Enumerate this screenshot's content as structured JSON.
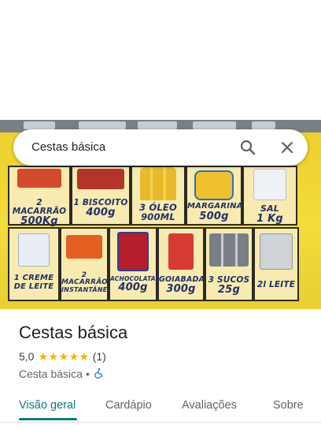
{
  "search": {
    "query": "Cestas básica",
    "search_icon": "search-icon",
    "clear_icon": "close-icon"
  },
  "photo": {
    "products": [
      {
        "line1": "2 MACARRÃO",
        "line2": "500Kg"
      },
      {
        "line1": "1 BISCOITO",
        "line2": "400g"
      },
      {
        "line1": "3 ÓLEO",
        "line2": "900ML"
      },
      {
        "line1": "MARGARINA",
        "line2": "500g"
      },
      {
        "line1": "SAL",
        "line2": "1 Kg"
      },
      {
        "line1": "1 CREME",
        "line2": "DE LEITE"
      },
      {
        "line1": "2 MACARRÃO",
        "line2": "INSTANTÂNEO"
      },
      {
        "line1": "ACHOCOLATADO",
        "line2": "400g"
      },
      {
        "line1": "GOIABADA",
        "line2": "300g"
      },
      {
        "line1": "3 SUCOS",
        "line2": "25g"
      },
      {
        "line1": "2l LEITE",
        "line2": ""
      }
    ]
  },
  "place": {
    "title": "Cestas básica",
    "rating": "5,0",
    "stars": "★★★★★",
    "review_count": "(1)",
    "category": "Cesta básica",
    "separator": "•",
    "accessibility_icon": "wheelchair-icon"
  },
  "tabs": [
    {
      "label": "Visão geral",
      "active": true
    },
    {
      "label": "Cardápio",
      "active": false
    },
    {
      "label": "Avaliações",
      "active": false
    },
    {
      "label": "Sobre",
      "active": false
    }
  ],
  "colors": {
    "accent": "#0b7c86",
    "star": "#f4b400",
    "poster_yellow": "#f1d92f",
    "label_blue": "#1f2f6b"
  }
}
